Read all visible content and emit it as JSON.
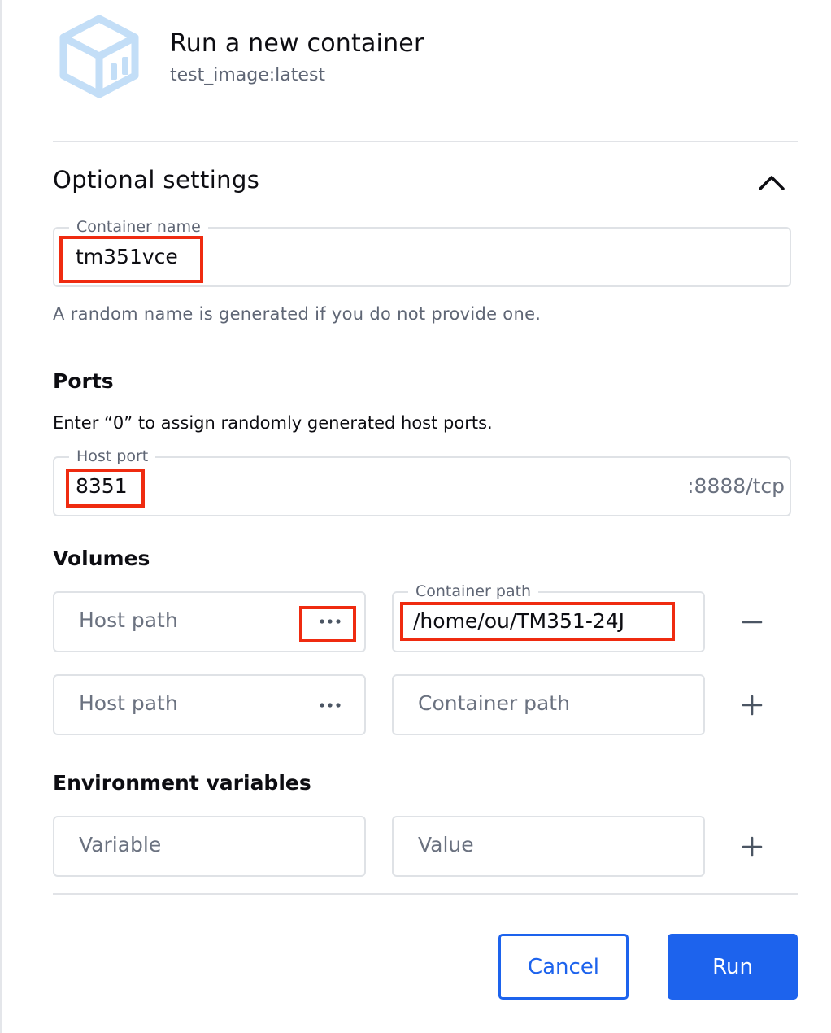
{
  "header": {
    "title": "Run a new container",
    "subtitle": "test_image:latest",
    "icon": "container-cube-icon"
  },
  "optional_settings": {
    "heading": "Optional settings",
    "expanded": true,
    "toggle_icon": "chevron-up-icon"
  },
  "container_name": {
    "legend": "Container name",
    "value": "tm351vce",
    "helper": "A random name is generated if you do not provide one."
  },
  "ports": {
    "heading": "Ports",
    "description": "Enter “0” to assign randomly generated host ports.",
    "host_port_legend": "Host port",
    "host_port_value": "8351",
    "container_port": ":8888/tcp"
  },
  "volumes": {
    "heading": "Volumes",
    "rows": [
      {
        "host_path_placeholder": "Host path",
        "container_path_legend": "Container path",
        "container_path_value": "/home/ou/TM351-24J",
        "action_icon": "minus-icon"
      },
      {
        "host_path_placeholder": "Host path",
        "container_path_placeholder": "Container path",
        "action_icon": "plus-icon"
      }
    ]
  },
  "environment": {
    "heading": "Environment variables",
    "variable_placeholder": "Variable",
    "value_placeholder": "Value",
    "action_icon": "plus-icon"
  },
  "buttons": {
    "cancel": "Cancel",
    "run": "Run"
  },
  "colors": {
    "accent": "#1d63ed",
    "highlight": "#ef2b10",
    "icon_tint": "#bfdcf7"
  }
}
